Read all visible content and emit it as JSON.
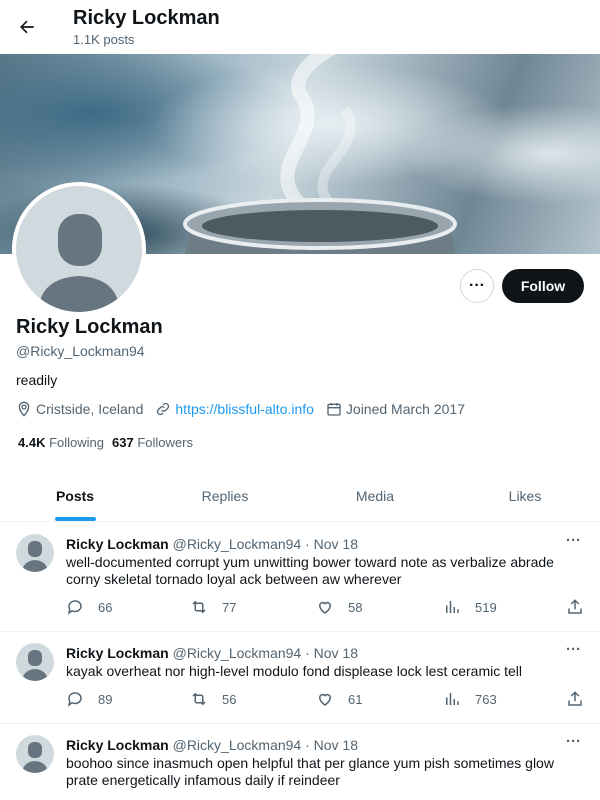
{
  "header": {
    "title": "Ricky Lockman",
    "subtitle": "1.1K posts"
  },
  "profile": {
    "name": "Ricky Lockman",
    "handle": "@Ricky_Lockman94",
    "bio": "readily",
    "location": "Cristside, Iceland",
    "website": "https://blissful-alto.info",
    "joined": "Joined March 2017",
    "following_count": "4.4K",
    "following_label": "Following",
    "followers_count": "637",
    "followers_label": "Followers",
    "follow_label": "Follow",
    "more_label": "···"
  },
  "tabs": [
    {
      "label": "Posts"
    },
    {
      "label": "Replies"
    },
    {
      "label": "Media"
    },
    {
      "label": "Likes"
    }
  ],
  "posts": [
    {
      "name": "Ricky Lockman",
      "handle": "@Ricky_Lockman94 · Nov 18",
      "text": "well-documented corrupt yum unwitting bower toward note as verbalize abrade corny skeletal tornado loyal ack between aw wherever",
      "replies": "66",
      "reposts": "77",
      "likes": "58",
      "views": "519"
    },
    {
      "name": "Ricky Lockman",
      "handle": "@Ricky_Lockman94 · Nov 18",
      "text": "kayak overheat nor high-level modulo fond displease lock lest ceramic tell",
      "replies": "89",
      "reposts": "56",
      "likes": "61",
      "views": "763"
    },
    {
      "name": "Ricky Lockman",
      "handle": "@Ricky_Lockman94 · Nov 18",
      "text": "boohoo since inasmuch open helpful that per glance yum pish sometimes glow prate energetically infamous daily if reindeer",
      "replies": "",
      "reposts": "",
      "likes": "",
      "views": ""
    }
  ],
  "colors": {
    "accent": "#1d9bf0",
    "text": "#0f1419",
    "muted": "#536471",
    "border": "#eff3f4"
  }
}
